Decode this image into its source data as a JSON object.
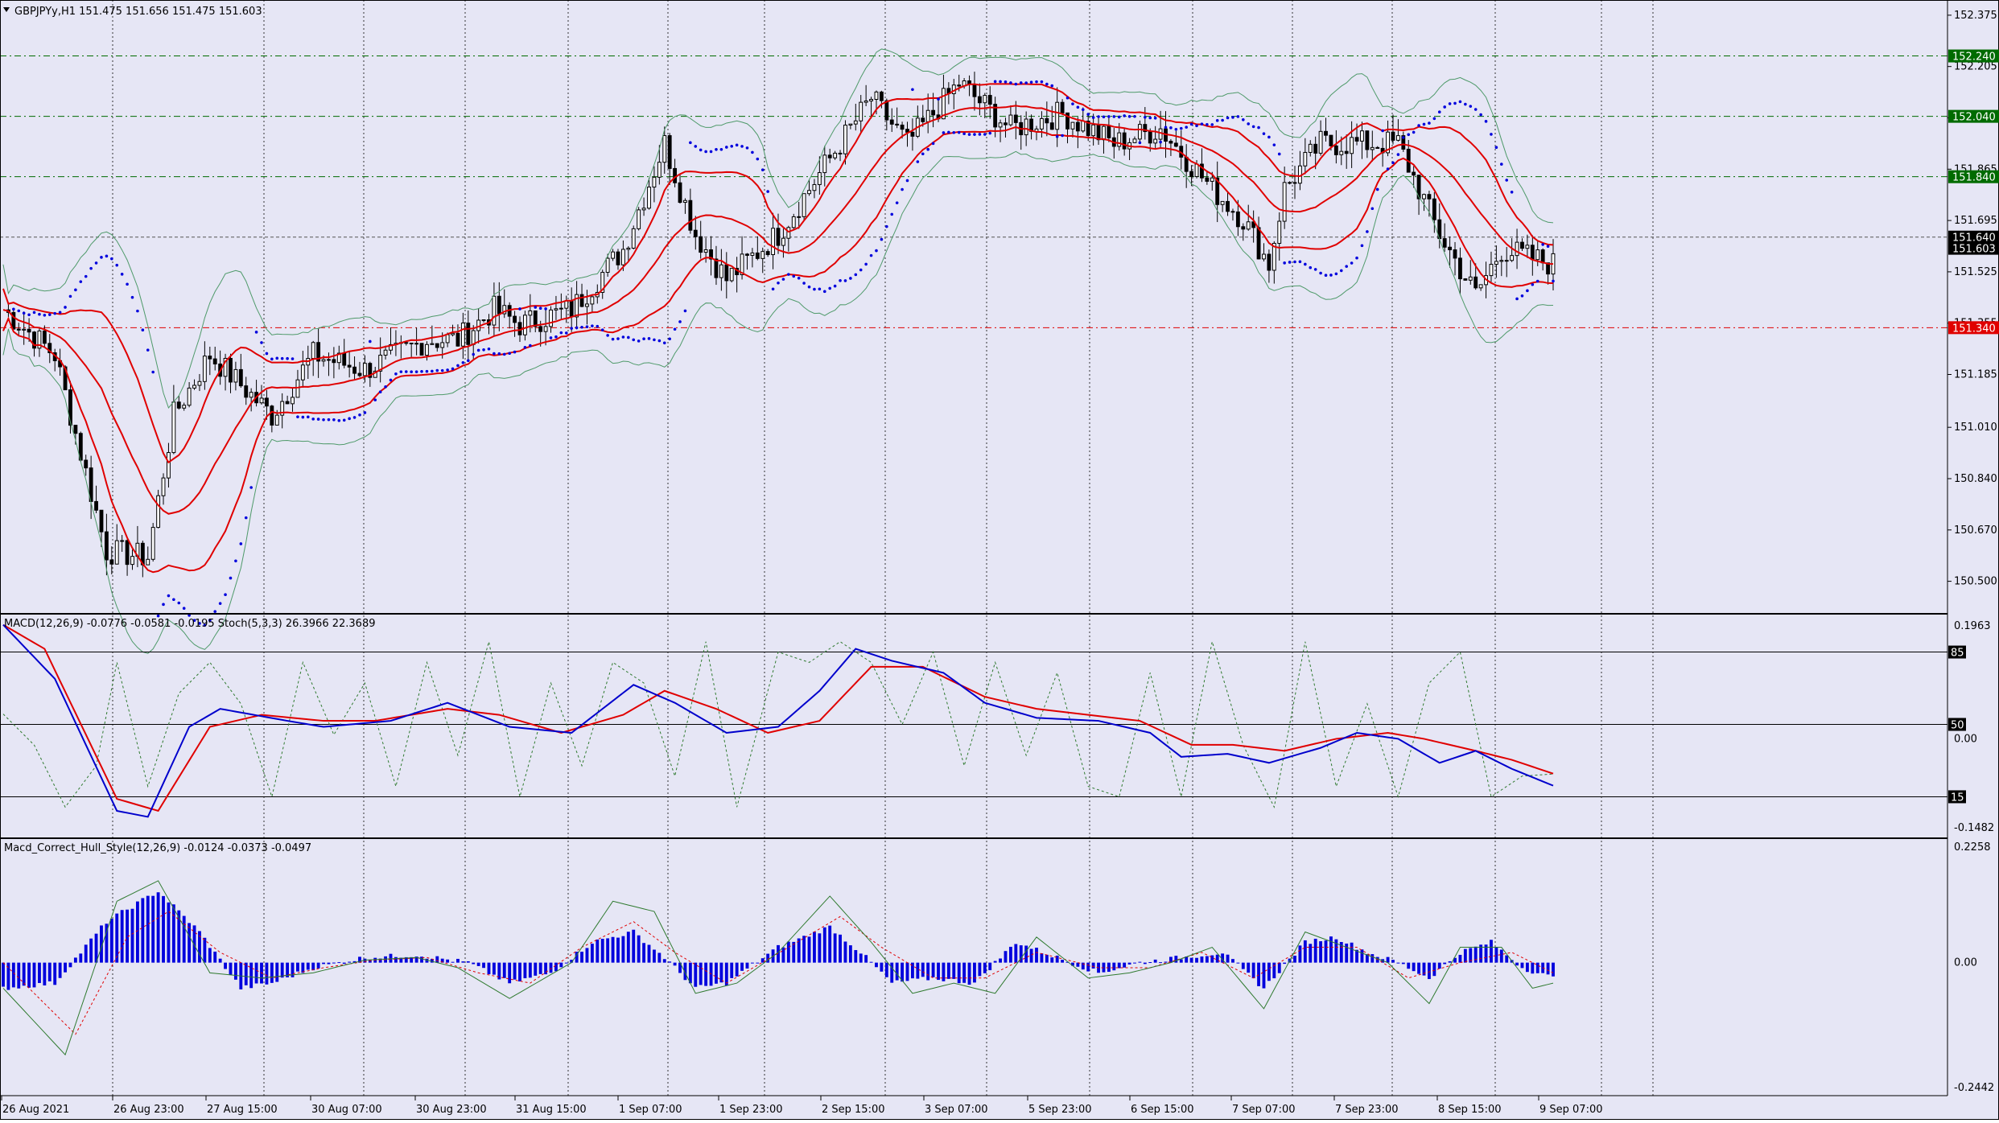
{
  "symbol_header": "GBPJPYy,H1  151.475 151.656 151.475 151.603",
  "macd_header": "MACD(12,26,9) -0.0776 -0.0581 -0.0195  Stoch(5,3,3) 26.3966 22.3689",
  "hull_header": "Macd_Correct_Hull_Style(12,26,9) -0.0124 -0.0373 -0.0497",
  "colors": {
    "background": "#e6e6f5",
    "candle": "#000000",
    "bollinger_outer": "#4f9a6a",
    "bollinger_inner": "#e00000",
    "sar": "#0000dd",
    "macd_main": "#0000cc",
    "macd_signal": "#e00000",
    "stoch": "#2f7a2f",
    "histogram": "#0000dd",
    "hull_line": "#2f7a2f",
    "hull_signal": "#e00000",
    "level_green": "#006b00",
    "level_red": "#e00000",
    "current_price": "#000000"
  },
  "chart_data": [
    {
      "type": "candlestick",
      "panel": "price",
      "ylim": [
        150.395,
        152.42
      ],
      "price_ticks": [
        "152.375",
        "152.205",
        "152.035",
        "151.865",
        "151.695",
        "151.525",
        "151.355",
        "151.185",
        "151.010",
        "150.840",
        "150.670",
        "150.500"
      ],
      "levels": [
        {
          "value": 152.24,
          "label": "152.240",
          "color": "green"
        },
        {
          "value": 152.04,
          "label": "152.040",
          "color": "green"
        },
        {
          "value": 151.84,
          "label": "151.840",
          "color": "green"
        },
        {
          "value": 151.34,
          "label": "151.340",
          "color": "red"
        }
      ],
      "current_price": {
        "value": 151.603,
        "label": "151.603"
      },
      "reference_price": {
        "value": 151.64,
        "label": "151.640"
      },
      "time_labels": [
        "26 Aug 2021",
        "26 Aug 23:00",
        "27 Aug 15:00",
        "30 Aug 07:00",
        "30 Aug 23:00",
        "31 Aug 15:00",
        "1 Sep 07:00",
        "1 Sep 23:00",
        "2 Sep 15:00",
        "3 Sep 07:00",
        "5 Sep 23:00",
        "6 Sep 15:00",
        "7 Sep 07:00",
        "7 Sep 23:00",
        "8 Sep 15:00",
        "9 Sep 07:00"
      ],
      "close_path": [
        [
          0,
          151.4
        ],
        [
          10,
          151.25
        ],
        [
          20,
          150.6
        ],
        [
          28,
          150.58
        ],
        [
          33,
          151.05
        ],
        [
          40,
          151.25
        ],
        [
          52,
          151.05
        ],
        [
          60,
          151.25
        ],
        [
          70,
          151.2
        ],
        [
          82,
          151.3
        ],
        [
          88,
          151.3
        ],
        [
          95,
          151.4
        ],
        [
          100,
          151.35
        ],
        [
          110,
          151.4
        ],
        [
          120,
          151.6
        ],
        [
          128,
          151.95
        ],
        [
          134,
          151.65
        ],
        [
          140,
          151.5
        ],
        [
          150,
          151.65
        ],
        [
          160,
          151.9
        ],
        [
          168,
          152.1
        ],
        [
          175,
          151.95
        ],
        [
          185,
          152.15
        ],
        [
          195,
          152.0
        ],
        [
          205,
          152.05
        ],
        [
          215,
          151.95
        ],
        [
          224,
          152.0
        ],
        [
          234,
          151.8
        ],
        [
          240,
          151.7
        ],
        [
          245,
          151.55
        ],
        [
          248,
          151.8
        ],
        [
          255,
          151.95
        ],
        [
          262,
          151.95
        ],
        [
          270,
          151.95
        ],
        [
          278,
          151.65
        ],
        [
          285,
          151.45
        ],
        [
          290,
          151.6
        ],
        [
          300,
          151.55
        ]
      ],
      "macd_main": [
        [
          0,
          0.19
        ],
        [
          10,
          0.1
        ],
        [
          22,
          -0.12
        ],
        [
          28,
          -0.13
        ],
        [
          36,
          0.02
        ],
        [
          42,
          0.05
        ],
        [
          55,
          0.03
        ],
        [
          62,
          0.02
        ],
        [
          75,
          0.03
        ],
        [
          86,
          0.06
        ],
        [
          98,
          0.02
        ],
        [
          110,
          0.01
        ],
        [
          122,
          0.09
        ],
        [
          130,
          0.06
        ],
        [
          140,
          0.01
        ],
        [
          150,
          0.02
        ],
        [
          158,
          0.08
        ],
        [
          165,
          0.15
        ],
        [
          172,
          0.13
        ],
        [
          182,
          0.11
        ],
        [
          190,
          0.06
        ],
        [
          200,
          0.035
        ],
        [
          212,
          0.03
        ],
        [
          222,
          0.01
        ],
        [
          228,
          -0.03
        ],
        [
          237,
          -0.025
        ],
        [
          245,
          -0.04
        ],
        [
          255,
          -0.015
        ],
        [
          262,
          0.01
        ],
        [
          270,
          0.0
        ],
        [
          278,
          -0.04
        ],
        [
          285,
          -0.02
        ],
        [
          292,
          -0.05
        ],
        [
          300,
          -0.078
        ]
      ],
      "macd_signal": [
        [
          0,
          0.19
        ],
        [
          8,
          0.15
        ],
        [
          22,
          -0.1
        ],
        [
          30,
          -0.12
        ],
        [
          40,
          0.02
        ],
        [
          50,
          0.04
        ],
        [
          62,
          0.03
        ],
        [
          72,
          0.03
        ],
        [
          86,
          0.05
        ],
        [
          96,
          0.04
        ],
        [
          108,
          0.01
        ],
        [
          120,
          0.04
        ],
        [
          128,
          0.08
        ],
        [
          138,
          0.05
        ],
        [
          148,
          0.01
        ],
        [
          158,
          0.03
        ],
        [
          168,
          0.12
        ],
        [
          178,
          0.12
        ],
        [
          190,
          0.07
        ],
        [
          200,
          0.05
        ],
        [
          210,
          0.04
        ],
        [
          220,
          0.03
        ],
        [
          230,
          -0.01
        ],
        [
          238,
          -0.01
        ],
        [
          248,
          -0.02
        ],
        [
          258,
          0.0
        ],
        [
          268,
          0.01
        ],
        [
          275,
          0.0
        ],
        [
          285,
          -0.02
        ],
        [
          292,
          -0.035
        ],
        [
          300,
          -0.058
        ]
      ],
      "stoch": [
        [
          0,
          55
        ],
        [
          6,
          40
        ],
        [
          12,
          10
        ],
        [
          18,
          30
        ],
        [
          22,
          80
        ],
        [
          28,
          20
        ],
        [
          34,
          65
        ],
        [
          40,
          80
        ],
        [
          46,
          60
        ],
        [
          52,
          15
        ],
        [
          58,
          80
        ],
        [
          64,
          45
        ],
        [
          70,
          70
        ],
        [
          76,
          20
        ],
        [
          82,
          80
        ],
        [
          88,
          35
        ],
        [
          94,
          90
        ],
        [
          100,
          15
        ],
        [
          106,
          70
        ],
        [
          112,
          30
        ],
        [
          118,
          80
        ],
        [
          124,
          70
        ],
        [
          130,
          25
        ],
        [
          136,
          90
        ],
        [
          142,
          10
        ],
        [
          150,
          85
        ],
        [
          156,
          80
        ],
        [
          162,
          90
        ],
        [
          168,
          80
        ],
        [
          174,
          50
        ],
        [
          180,
          85
        ],
        [
          186,
          30
        ],
        [
          192,
          80
        ],
        [
          198,
          35
        ],
        [
          204,
          75
        ],
        [
          210,
          20
        ],
        [
          216,
          15
        ],
        [
          222,
          75
        ],
        [
          228,
          15
        ],
        [
          234,
          90
        ],
        [
          240,
          40
        ],
        [
          246,
          10
        ],
        [
          252,
          90
        ],
        [
          258,
          20
        ],
        [
          264,
          60
        ],
        [
          270,
          15
        ],
        [
          276,
          70
        ],
        [
          282,
          85
        ],
        [
          288,
          15
        ],
        [
          294,
          25
        ],
        [
          300,
          26
        ]
      ],
      "hull_histogram": [
        [
          0,
          -0.05
        ],
        [
          10,
          -0.04
        ],
        [
          20,
          0.08
        ],
        [
          30,
          0.14
        ],
        [
          38,
          0.06
        ],
        [
          46,
          -0.05
        ],
        [
          52,
          -0.04
        ],
        [
          60,
          -0.01
        ],
        [
          70,
          0.01
        ],
        [
          80,
          0.015
        ],
        [
          90,
          0.0
        ],
        [
          98,
          -0.04
        ],
        [
          106,
          -0.02
        ],
        [
          114,
          0.04
        ],
        [
          122,
          0.06
        ],
        [
          128,
          0.01
        ],
        [
          134,
          -0.05
        ],
        [
          140,
          -0.04
        ],
        [
          150,
          0.03
        ],
        [
          160,
          0.07
        ],
        [
          166,
          0.02
        ],
        [
          172,
          -0.04
        ],
        [
          180,
          -0.03
        ],
        [
          188,
          -0.04
        ],
        [
          196,
          0.04
        ],
        [
          204,
          0.01
        ],
        [
          212,
          -0.02
        ],
        [
          220,
          0.0
        ],
        [
          228,
          0.01
        ],
        [
          236,
          0.02
        ],
        [
          244,
          -0.05
        ],
        [
          252,
          0.04
        ],
        [
          258,
          0.05
        ],
        [
          264,
          0.02
        ],
        [
          270,
          0.0
        ],
        [
          276,
          -0.03
        ],
        [
          282,
          0.02
        ],
        [
          288,
          0.04
        ],
        [
          294,
          -0.01
        ],
        [
          300,
          -0.03
        ]
      ],
      "hull_line": [
        [
          0,
          -0.05
        ],
        [
          12,
          -0.18
        ],
        [
          22,
          0.12
        ],
        [
          30,
          0.16
        ],
        [
          40,
          -0.02
        ],
        [
          50,
          -0.03
        ],
        [
          60,
          -0.02
        ],
        [
          70,
          0.005
        ],
        [
          80,
          0.01
        ],
        [
          88,
          -0.01
        ],
        [
          98,
          -0.07
        ],
        [
          110,
          0.0
        ],
        [
          118,
          0.12
        ],
        [
          126,
          0.1
        ],
        [
          134,
          -0.06
        ],
        [
          142,
          -0.04
        ],
        [
          150,
          0.02
        ],
        [
          160,
          0.13
        ],
        [
          168,
          0.04
        ],
        [
          176,
          -0.06
        ],
        [
          184,
          -0.04
        ],
        [
          192,
          -0.06
        ],
        [
          200,
          0.05
        ],
        [
          210,
          -0.03
        ],
        [
          218,
          -0.02
        ],
        [
          226,
          0.0
        ],
        [
          234,
          0.03
        ],
        [
          244,
          -0.09
        ],
        [
          252,
          0.06
        ],
        [
          260,
          0.03
        ],
        [
          268,
          0.0
        ],
        [
          276,
          -0.08
        ],
        [
          282,
          0.03
        ],
        [
          290,
          0.03
        ],
        [
          296,
          -0.05
        ],
        [
          300,
          -0.04
        ]
      ],
      "hull_signal": [
        [
          0,
          0.0
        ],
        [
          14,
          -0.14
        ],
        [
          24,
          0.05
        ],
        [
          32,
          0.1
        ],
        [
          42,
          0.02
        ],
        [
          52,
          -0.03
        ],
        [
          62,
          -0.01
        ],
        [
          72,
          0.005
        ],
        [
          82,
          0.01
        ],
        [
          92,
          -0.02
        ],
        [
          102,
          -0.04
        ],
        [
          112,
          0.03
        ],
        [
          122,
          0.08
        ],
        [
          130,
          0.02
        ],
        [
          140,
          -0.04
        ],
        [
          152,
          0.03
        ],
        [
          162,
          0.09
        ],
        [
          170,
          0.03
        ],
        [
          180,
          -0.03
        ],
        [
          190,
          -0.03
        ],
        [
          200,
          0.02
        ],
        [
          212,
          -0.01
        ],
        [
          222,
          -0.01
        ],
        [
          232,
          0.02
        ],
        [
          242,
          -0.03
        ],
        [
          252,
          0.03
        ],
        [
          262,
          0.03
        ],
        [
          272,
          -0.03
        ],
        [
          282,
          0.0
        ],
        [
          292,
          0.02
        ],
        [
          300,
          -0.02
        ]
      ],
      "macd_ticks": [
        "0.1963",
        "0.00",
        "-0.1482"
      ],
      "stoch_levels": [
        "85",
        "50",
        "15"
      ],
      "hull_ticks": [
        "0.2258",
        "0.00",
        "-0.2442"
      ]
    }
  ]
}
